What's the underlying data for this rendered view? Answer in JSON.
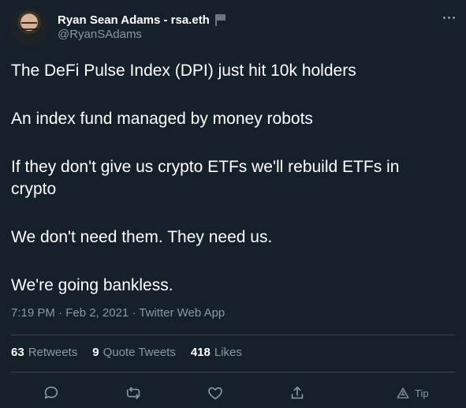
{
  "user": {
    "display_name": "Ryan Sean Adams - rsa.eth",
    "handle": "@RyanSAdams"
  },
  "tweet": {
    "paragraphs": [
      [
        "The DeFi Pulse Index (DPI) just hit 10k holders"
      ],
      [
        "An index fund managed by money robots"
      ],
      [
        "If they don't give us crypto ETFs we'll rebuild ETFs in",
        "crypto"
      ],
      [
        "We don't need them. They need us."
      ],
      [
        "We're going bankless."
      ]
    ],
    "meta": "7:19 PM · Feb 2, 2021 · Twitter Web App"
  },
  "stats": {
    "retweets_count": "63",
    "retweets_label": "Retweets",
    "quote_tweets_count": "9",
    "quote_tweets_label": "Quote Tweets",
    "likes_count": "418",
    "likes_label": "Likes"
  },
  "actions": {
    "tip_label": "Tip"
  },
  "colors": {
    "background": "#15202b",
    "primary_text": "#ffffff",
    "secondary_text": "#8899a6",
    "divider": "#38444d"
  },
  "icons": {
    "reply": "comment-icon",
    "retweet": "retweet-icon",
    "like": "heart-icon",
    "share": "share-icon",
    "tip": "tip-icon",
    "more": "more-icon",
    "flag": "flag-icon"
  }
}
